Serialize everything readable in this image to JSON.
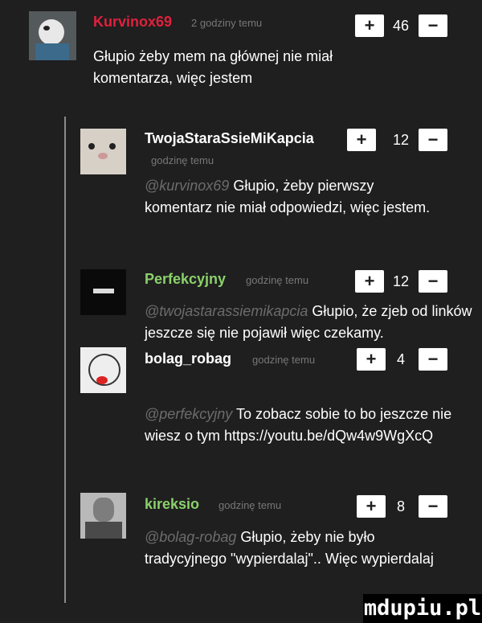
{
  "comments": [
    {
      "nick": "Kurvinox69",
      "nick_color": "#e0213c",
      "time": "2 godziny temu",
      "score": "46",
      "text": "Głupio żeby mem na głównej nie miał komentarza, więc jestem"
    },
    {
      "nick": "TwojaStaraSsieMiKapcia",
      "nick_color": "#ffffff",
      "time": "godzinę temu",
      "score": "12",
      "mention": "@kurvinox69",
      "text": "Głupio, żeby pierwszy komentarz nie miał odpowiedzi, więc jestem."
    },
    {
      "nick": "Perfekcyjny",
      "nick_color": "#8bd16b",
      "time": "godzinę temu",
      "score": "12",
      "mention": "@twojastarassiemikapcia",
      "text": "Głupio, że zjeb od linków jeszcze się nie pojawił więc czekamy."
    },
    {
      "nick": "bolag_robag",
      "nick_color": "#ffffff",
      "time": "godzinę temu",
      "score": "4",
      "mention": "@perfekcyjny",
      "text": "To zobacz sobie to bo jeszcze nie wiesz o tym https://youtu.be/dQw4w9WgXcQ"
    },
    {
      "nick": "kireksio",
      "nick_color": "#8bd16b",
      "time": "godzinę temu",
      "score": "8",
      "mention": "@bolag-robag",
      "text": "Głupio, żeby nie było tradycyjnego \"wypierdalaj\".. Więc wypierdalaj"
    }
  ],
  "vote": {
    "plus": "+",
    "minus": "−"
  },
  "watermark": "mdupiu.pl"
}
